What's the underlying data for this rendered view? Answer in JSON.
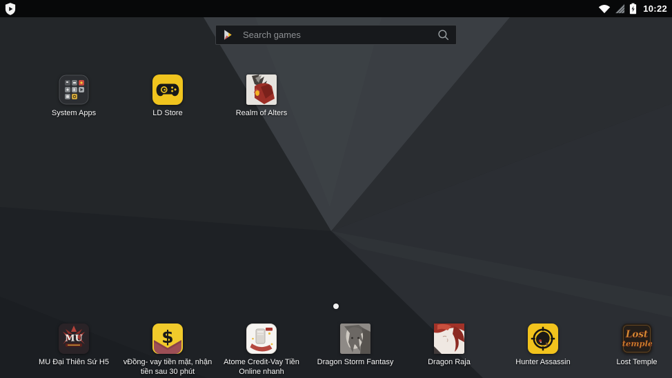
{
  "status_bar": {
    "time": "10:22",
    "icons": [
      "ldplayer-shield-icon",
      "wifi-icon",
      "cellular-no-signal-icon",
      "battery-charging-icon"
    ]
  },
  "search": {
    "placeholder": "Search games",
    "icons": [
      "google-play-icon",
      "search-icon"
    ]
  },
  "desktop_apps": [
    {
      "label": "System Apps",
      "icon": "system-apps-folder"
    },
    {
      "label": "LD Store",
      "icon": "ld-store"
    },
    {
      "label": "Realm of Alters",
      "icon": "realm-of-alters"
    }
  ],
  "page_indicator": {
    "pages": 1,
    "active_page": 1
  },
  "dock_apps": [
    {
      "label": "MU Đại Thiên Sứ H5",
      "icon": "mu-dai-thien-su",
      "icon_text": [
        "MU"
      ]
    },
    {
      "label": "vĐồng- vay tiền mặt, nhận tiền sau 30 phút",
      "icon": "vdong",
      "icon_text": [
        "$"
      ]
    },
    {
      "label": "Atome Credit-Vay Tiền Online nhanh",
      "icon": "atome-credit"
    },
    {
      "label": "Dragon Storm Fantasy",
      "icon": "dragon-storm-fantasy"
    },
    {
      "label": "Dragon Raja",
      "icon": "dragon-raja"
    },
    {
      "label": "Hunter Assassin",
      "icon": "hunter-assassin"
    },
    {
      "label": "Lost Temple",
      "icon": "lost-temple",
      "icon_text": [
        "Lost",
        "temple"
      ]
    }
  ],
  "colors": {
    "wallpaper_base": "#24272b",
    "wallpaper_light_facet": "#3a3e43",
    "wallpaper_dark_facet": "#1d2024",
    "status_bar_bg": "#070809",
    "search_bar_bg": "#17191c",
    "accent_yellow": "#f0c41e",
    "label_text": "#f7f7f7"
  }
}
